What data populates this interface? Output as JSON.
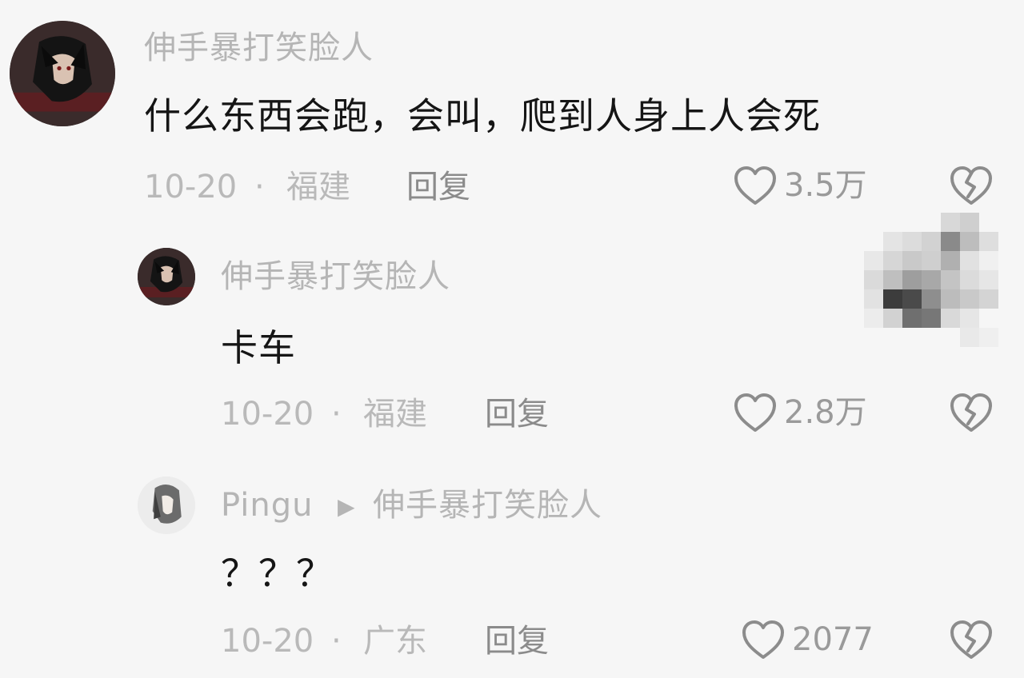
{
  "comments": [
    {
      "username": "伸手暴打笑脸人",
      "text": "什么东西会跑，会叫，爬到人身上人会死",
      "date": "10-20",
      "sep": "·",
      "location": "福建",
      "reply_label": "回复",
      "likes": "3.5万"
    },
    {
      "username": "伸手暴打笑脸人",
      "text": "卡车",
      "date": "10-20",
      "sep": "·",
      "location": "福建",
      "reply_label": "回复",
      "likes": "2.8万"
    },
    {
      "username": "Pingu",
      "reply_to": "伸手暴打笑脸人",
      "text": "？？？",
      "date": "10-20",
      "sep": "·",
      "location": "广东",
      "reply_label": "回复",
      "likes": "2077"
    }
  ],
  "icons": {
    "like": "heart-outline-icon",
    "dislike": "broken-heart-icon",
    "reply_arrow": "triangle-right-icon"
  },
  "colors": {
    "background": "#f6f6f6",
    "username": "#b5b5b5",
    "content": "#151515",
    "meta": "#b9b9b9",
    "reply": "#8b8b8b"
  }
}
